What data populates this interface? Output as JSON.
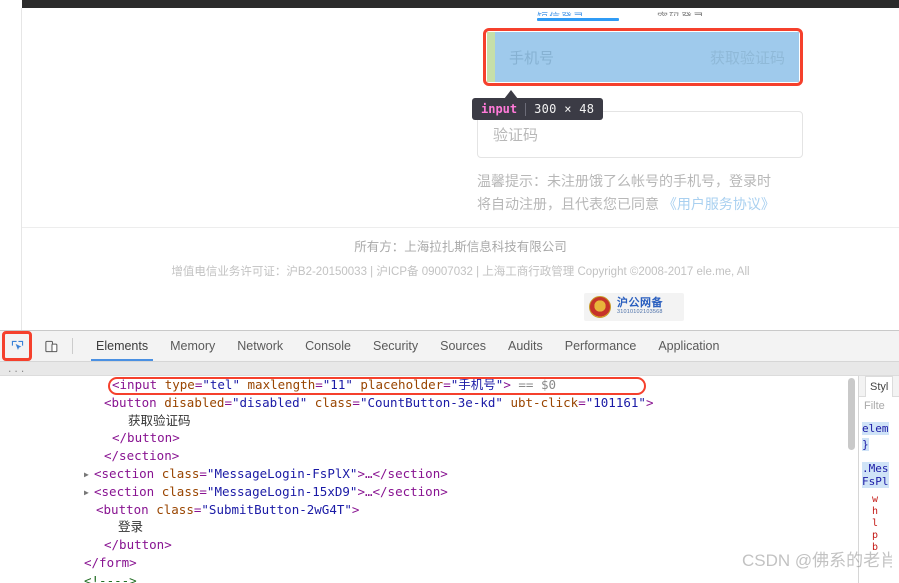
{
  "page": {
    "ghost_tabs": [
      "短信登录",
      "密码登录"
    ],
    "phone_input": {
      "placeholder": "手机号",
      "button_label": "获取验证码"
    },
    "tooltip": {
      "tag": "input",
      "dimensions": "300 × 48"
    },
    "captcha_input": {
      "placeholder": "验证码"
    },
    "hint": {
      "line1": "温馨提示：未注册饿了么帐号的手机号，登录时",
      "line2_prefix": "将自动注册，且代表您已同意 ",
      "line2_link": "《用户服务协议》"
    },
    "footer": {
      "owner": "所有方：上海拉扎斯信息科技有限公司",
      "license": "增值电信业务许可证：沪B2-20150033 | 沪ICP备 09007032 | 上海工商行政管理 Copyright ©2008-2017 ele.me, All"
    },
    "badge": {
      "title": "沪公网备",
      "number": "31010102103568"
    }
  },
  "devtools": {
    "icons": {
      "inspect": "inspect-cursor-icon",
      "device": "device-toolbar-icon"
    },
    "tabs": [
      {
        "label": "Elements",
        "active": true
      },
      {
        "label": "Memory",
        "active": false
      },
      {
        "label": "Network",
        "active": false
      },
      {
        "label": "Console",
        "active": false
      },
      {
        "label": "Security",
        "active": false
      },
      {
        "label": "Sources",
        "active": false
      },
      {
        "label": "Audits",
        "active": false
      },
      {
        "label": "Performance",
        "active": false
      },
      {
        "label": "Application",
        "active": false
      }
    ],
    "breadcrumb_more": "...",
    "dom": {
      "line_input": {
        "open": "<",
        "tag": "input",
        "attr1": "type",
        "val1": "\"tel\"",
        "attr2": "maxlength",
        "val2": "\"11\"",
        "attr3": "placeholder",
        "val3": "\"手机号\"",
        "close": ">",
        "selected_marker": "== $0"
      },
      "line_button_open": {
        "open": "<",
        "tag": "button",
        "attr1": "disabled",
        "val1": "\"disabled\"",
        "attr2": "class",
        "val2": "\"CountButton-3e-kd\"",
        "attr3": "ubt-click",
        "val3": "\"101161\"",
        "close": ">"
      },
      "line_button_text": "获取验证码",
      "line_button_close": "</button>",
      "line_section_close": "</section>",
      "line_section_a": {
        "open": "<",
        "tag": "section",
        "attr1": "class",
        "val1": "\"MessageLogin-FsPlX\"",
        "close": ">",
        "ellipsis": "…",
        "end": "</section>"
      },
      "line_section_b": {
        "open": "<",
        "tag": "section",
        "attr1": "class",
        "val1": "\"MessageLogin-15xD9\"",
        "close": ">",
        "ellipsis": "…",
        "end": "</section>"
      },
      "line_submit_open": {
        "open": "<",
        "tag": "button",
        "attr1": "class",
        "val1": "\"SubmitButton-2wG4T\"",
        "close": ">"
      },
      "line_submit_text": "登录",
      "line_submit_close": "</button>",
      "line_form_close": "</form>",
      "line_comment": "<!---->"
    },
    "styles_pane": {
      "tab_label": "Styl",
      "filter_placeholder": "Filte",
      "rule_element": "elem",
      "rule_brace": "}",
      "rule_selector_1": ".Mes",
      "rule_selector_2": "FsPl",
      "props": [
        "w",
        "h",
        "l",
        "p",
        "b"
      ]
    }
  },
  "watermark": "CSDN @佛系的老肖",
  "colors": {
    "inspect_red": "#f5402c",
    "highlight_content": "#9fcaec",
    "highlight_padding": "#c6dfa9",
    "tooltip_bg": "#3b3b45",
    "tooltip_tag": "#ff7ad9",
    "tab_active": "#4a90e2"
  }
}
